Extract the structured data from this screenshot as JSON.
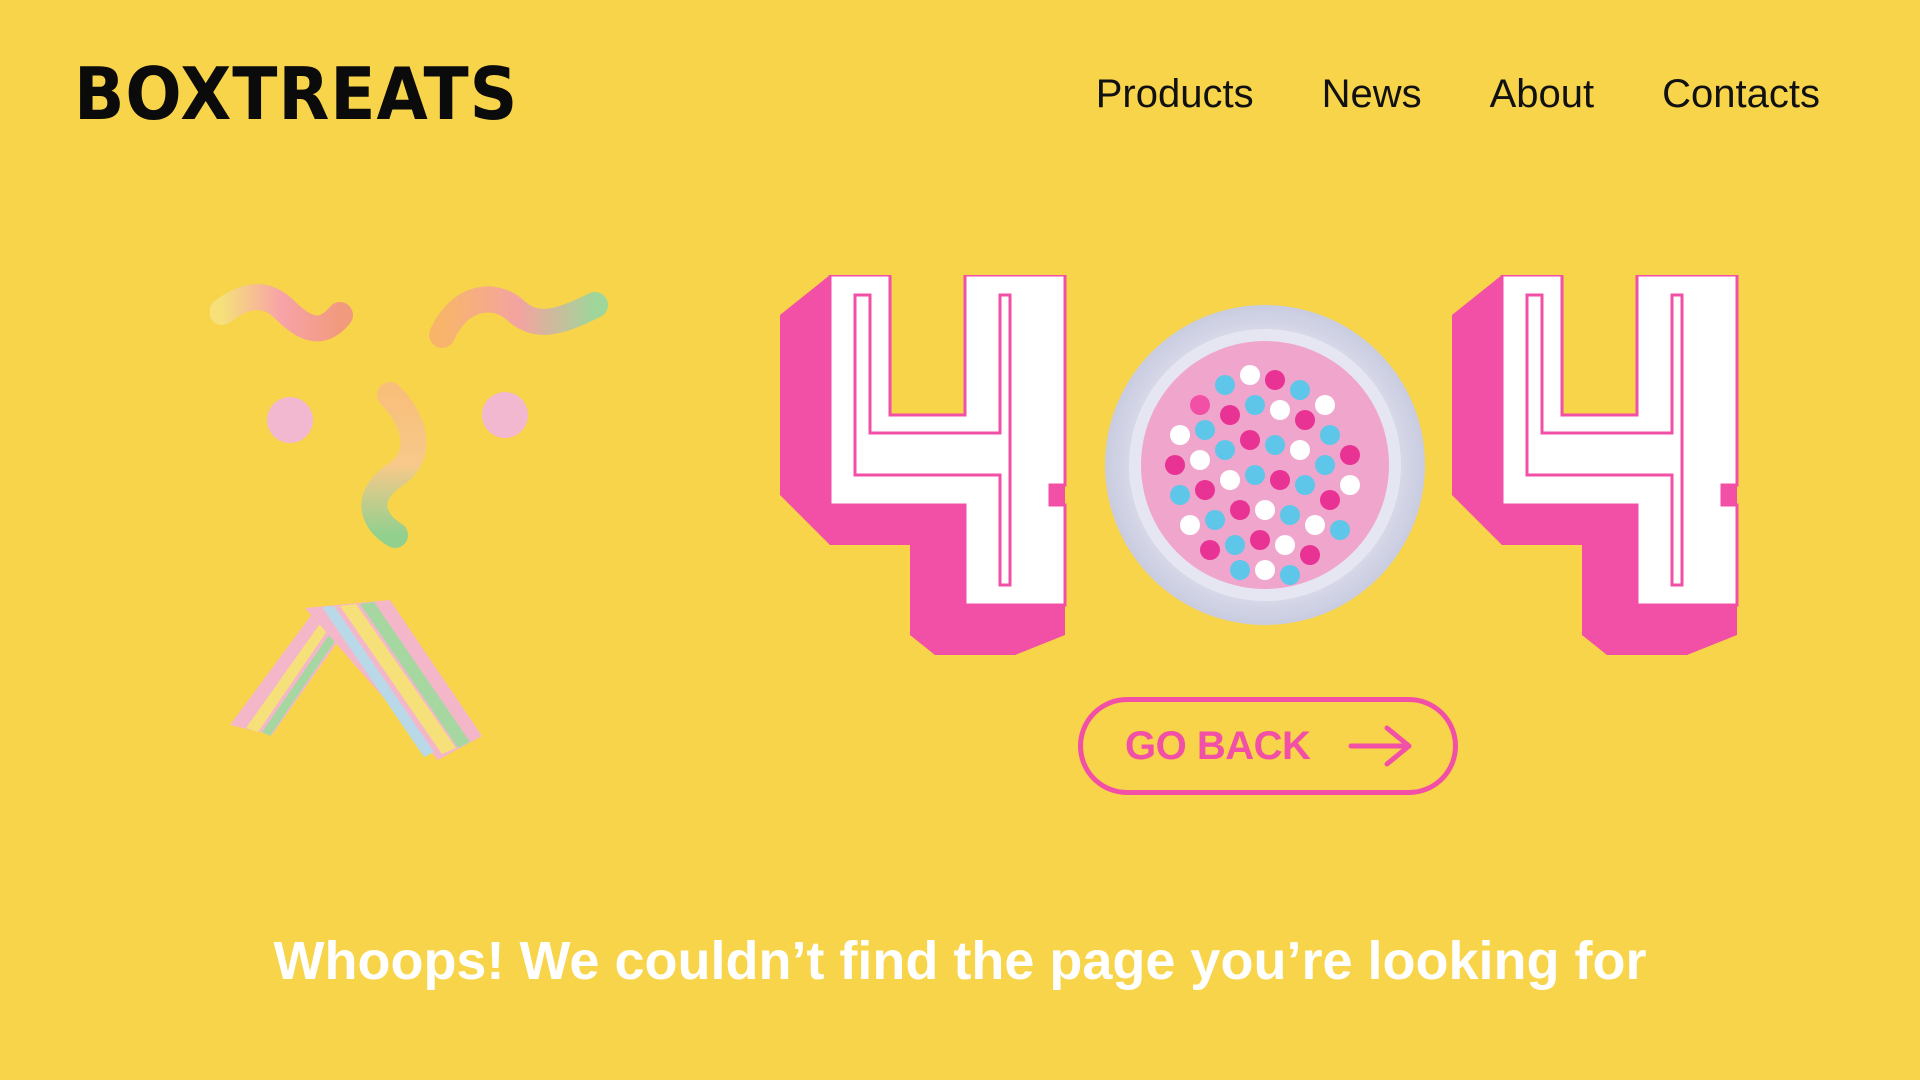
{
  "header": {
    "logo_text": "BOXTREATS",
    "nav": [
      {
        "label": "Products"
      },
      {
        "label": "News"
      },
      {
        "label": "About"
      },
      {
        "label": "Contacts"
      }
    ]
  },
  "error": {
    "code_first_digit": "4",
    "code_last_digit": "4"
  },
  "actions": {
    "go_back_label": "GO BACK",
    "go_back_icon": "arrow-right-icon"
  },
  "message": "Whoops! We couldn’t find the page you’re looking for",
  "colors": {
    "background": "#F7D44A",
    "accent_pink": "#F24FA6",
    "text_dark": "#0B0B0B",
    "text_light": "#FFFFFF"
  }
}
